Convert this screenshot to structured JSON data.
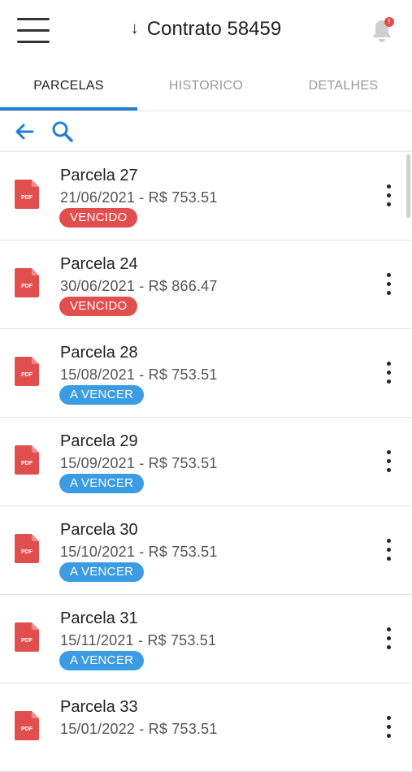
{
  "header": {
    "title_arrow": "↓",
    "title": "Contrato 58459",
    "notification_count": "!"
  },
  "tabs": [
    {
      "label": "PARCELAS",
      "active": true
    },
    {
      "label": "HISTORICO",
      "active": false
    },
    {
      "label": "DETALHES",
      "active": false
    }
  ],
  "toolbar": {
    "back_icon": "arrow-left-icon",
    "search_icon": "search-icon"
  },
  "colors": {
    "accent": "#1f7fd1",
    "vencido": "#e04e4e",
    "a_vencer": "#3b9be3",
    "pdf": "#e04e4e"
  },
  "parcelas": [
    {
      "title": "Parcela 27",
      "subtitle": "21/06/2021 - R$ 753.51",
      "status": "VENCIDO",
      "status_key": "vencido"
    },
    {
      "title": "Parcela 24",
      "subtitle": "30/06/2021 - R$ 866.47",
      "status": "VENCIDO",
      "status_key": "vencido"
    },
    {
      "title": "Parcela 28",
      "subtitle": "15/08/2021 - R$ 753.51",
      "status": "A VENCER",
      "status_key": "a_vencer"
    },
    {
      "title": "Parcela 29",
      "subtitle": "15/09/2021 - R$ 753.51",
      "status": "A VENCER",
      "status_key": "a_vencer"
    },
    {
      "title": "Parcela 30",
      "subtitle": "15/10/2021 - R$ 753.51",
      "status": "A VENCER",
      "status_key": "a_vencer"
    },
    {
      "title": "Parcela 31",
      "subtitle": "15/11/2021 - R$ 753.51",
      "status": "A VENCER",
      "status_key": "a_vencer"
    },
    {
      "title": "Parcela 33",
      "subtitle": "15/01/2022 - R$ 753.51",
      "status": "",
      "status_key": ""
    }
  ],
  "pdf_icon_label": "PDF"
}
